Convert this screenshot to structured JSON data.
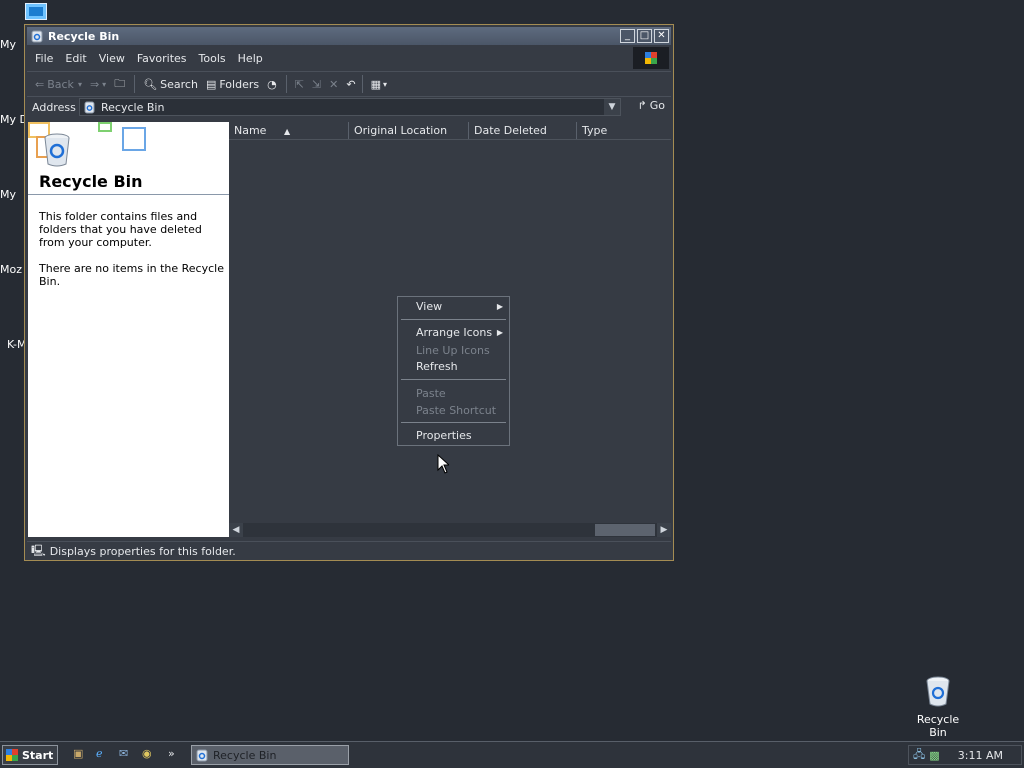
{
  "desktop": {
    "left_items": [
      "My",
      "My D",
      "My",
      "Moz",
      "K-M"
    ],
    "recycle_bin_label": "Recycle Bin"
  },
  "window": {
    "title": "Recycle Bin",
    "controls": {
      "minimize": "_",
      "maximize": "□",
      "close": "✕"
    },
    "menu": [
      "File",
      "Edit",
      "View",
      "Favorites",
      "Tools",
      "Help"
    ],
    "toolbar": {
      "back": "Back",
      "search": "Search",
      "folders": "Folders"
    },
    "address": {
      "label": "Address",
      "value": "Recycle Bin",
      "go": "Go"
    },
    "task_pane": {
      "title": "Recycle Bin",
      "description": "This folder contains files and folders that you have deleted from your computer.",
      "empty_note": "There are no items in the Recycle Bin."
    },
    "columns": [
      "Name",
      "Original Location",
      "Date Deleted",
      "Type"
    ],
    "status": "Displays properties for this folder."
  },
  "context_menu": {
    "view": "View",
    "arrange_icons": "Arrange Icons",
    "line_up_icons": "Line Up Icons",
    "refresh": "Refresh",
    "paste": "Paste",
    "paste_shortcut": "Paste Shortcut",
    "properties": "Properties"
  },
  "taskbar": {
    "start": "Start",
    "task_button": "Recycle Bin",
    "clock": "3:11 AM",
    "chevron": "»"
  }
}
